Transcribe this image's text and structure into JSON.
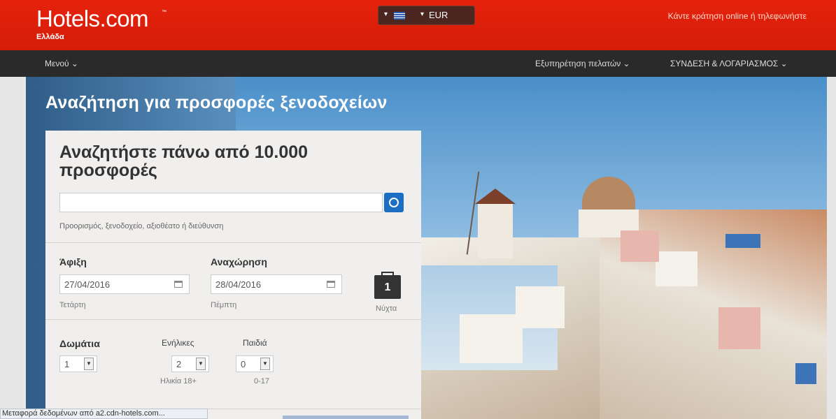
{
  "header": {
    "logo": "Hotels.com",
    "logo_tm": "™",
    "logo_sub": "Ελλάδα",
    "currency": "EUR",
    "booking_text": "Κάντε κράτηση online ή τηλεφωνήστε"
  },
  "nav": {
    "menu": "Μενού ⌄",
    "support": "Εξυπηρέτηση πελατών ⌄",
    "login": "ΣΥΝΔΕΣΗ & ΛΟΓΑΡΙΑΣΜΟΣ ⌄"
  },
  "hero": {
    "title": "Αναζήτηση για προσφορές ξενοδοχείων"
  },
  "search": {
    "title": "Αναζητήστε πάνω από 10.000 προσφορές",
    "destination_value": "",
    "destination_hint": "Προορισμός, ξενοδοχείο, αξιοθέατο ή διεύθυνση",
    "checkin_label": "Άφιξη",
    "checkin_value": "27/04/2016",
    "checkin_day": "Τετάρτη",
    "checkout_label": "Αναχώρηση",
    "checkout_value": "28/04/2016",
    "checkout_day": "Πέμπτη",
    "nights_value": "1",
    "nights_label": "Νύχτα",
    "rooms_label": "Δωμάτια",
    "rooms_value": "1",
    "adults_label": "Ενήλικες",
    "adults_value": "2",
    "adults_hint": "Ηλικία 18+",
    "children_label": "Παιδιά",
    "children_value": "0",
    "children_hint": "0-17"
  },
  "statusbar": {
    "text": "Μεταφορά δεδομένων από a2.cdn-hotels.com..."
  },
  "colors": {
    "brand_red": "#d41d08",
    "nav_dark": "#2a2a2a",
    "accent_blue": "#1b6ec2"
  }
}
